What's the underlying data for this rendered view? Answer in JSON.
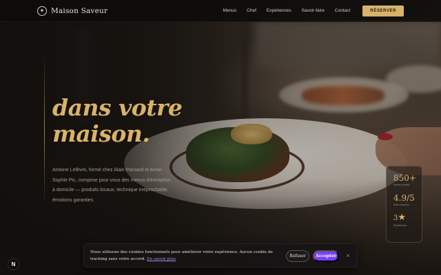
{
  "brand": {
    "mark_icon": "sparkle-icon",
    "mark_glyph": "✦",
    "name": "Maison Saveur"
  },
  "nav": {
    "items": [
      {
        "label": "Menus"
      },
      {
        "label": "Chef"
      },
      {
        "label": "Expériences"
      },
      {
        "label": "Savoir-faire"
      },
      {
        "label": "Contact"
      }
    ],
    "cta_label": "RÉSERVER"
  },
  "hero": {
    "title_line1": "dans votre",
    "title_line2": "maison.",
    "description": "Antoine Lefèvre, formé chez Alain Passard et Anne-Sophie Pic, compose pour vous des menus d'exception à domicile — produits locaux, technique irréprochable, émotions garanties."
  },
  "stats": [
    {
      "value": "850+",
      "label": "Soirées créées"
    },
    {
      "value": "4.9/5",
      "label": "Note moyenne"
    },
    {
      "value": "3",
      "icon": "star-icon",
      "glyph": "★",
      "label": "Expériences"
    }
  ],
  "cookie_banner": {
    "text": "Nous utilisons des cookies fonctionnels pour améliorer votre expérience. Aucun cookie de tracking sans votre accord.",
    "link": "En savoir plus",
    "refuse_label": "Refuser",
    "accept_label": "Accepter",
    "close_glyph": "×"
  },
  "corner_badge": {
    "glyph": "N"
  },
  "colors": {
    "accent_gold": "#d9b26a",
    "cookie_accept": "#7b3ff2",
    "background": "#171411"
  }
}
